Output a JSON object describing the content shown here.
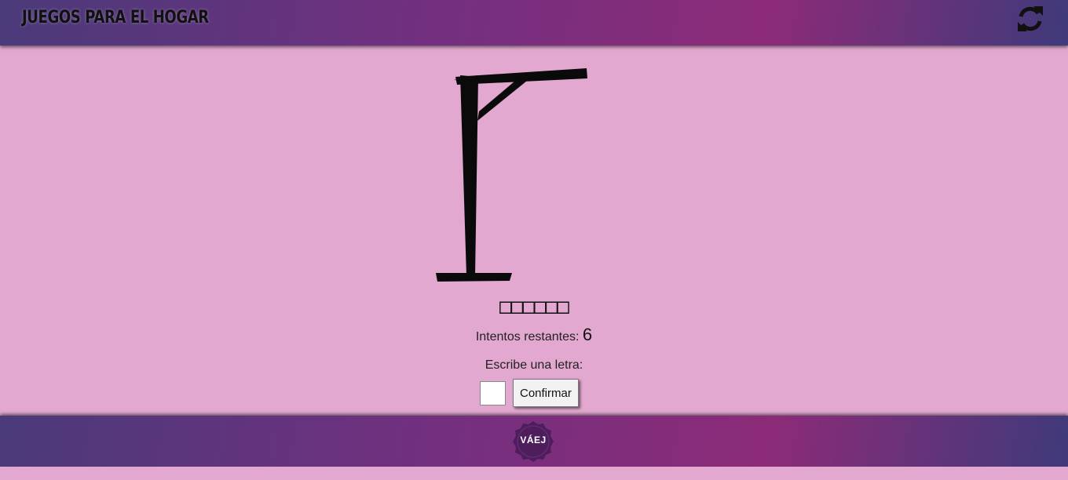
{
  "header": {
    "brand": "JUEGOS PARA EL HOGAR",
    "refresh_icon": "refresh-icon"
  },
  "game": {
    "hidden_word": "□□□□□□",
    "attempts_label": "Intentos restantes:",
    "attempts_remaining": "6",
    "prompt": "Escribe una letra:",
    "letter_input_value": "",
    "confirm_label": "Confirmar"
  },
  "footer": {
    "logo_text": "VÁEJ"
  },
  "colors": {
    "background": "#e2a8d0",
    "bar_start": "#4a3a7a",
    "bar_mid": "#8c2b78",
    "logo": "#4e1e5c"
  }
}
